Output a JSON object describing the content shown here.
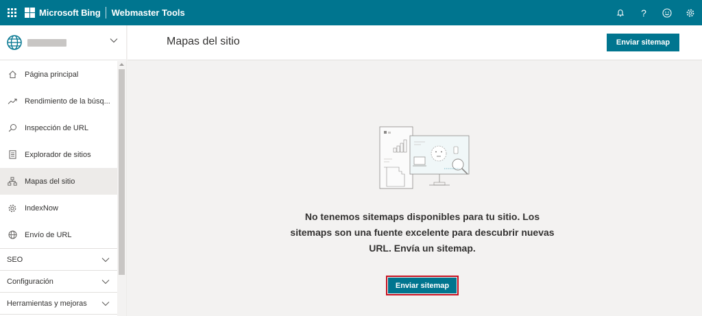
{
  "topbar": {
    "brand": "Microsoft Bing",
    "product": "Webmaster Tools",
    "background": "#00758f",
    "icons": [
      "waffle-icon",
      "bell-icon",
      "help-icon",
      "smiley-icon",
      "gear-icon"
    ],
    "help_glyph": "?"
  },
  "sidebar": {
    "nav_items": [
      {
        "label": "Página principal",
        "icon": "home-icon"
      },
      {
        "label": "Rendimiento de la búsq...",
        "icon": "trend-icon"
      },
      {
        "label": "Inspección de URL",
        "icon": "search-icon"
      },
      {
        "label": "Explorador de sitios",
        "icon": "document-icon"
      },
      {
        "label": "Mapas del sitio",
        "icon": "sitemap-icon",
        "active": true
      },
      {
        "label": "IndexNow",
        "icon": "gear-icon"
      },
      {
        "label": "Envío de URL",
        "icon": "globe-icon"
      }
    ],
    "groups": [
      {
        "label": "SEO"
      },
      {
        "label": "Configuración"
      },
      {
        "label": "Herramientas y mejoras"
      }
    ]
  },
  "header": {
    "title": "Mapas del sitio",
    "submit_label": "Enviar sitemap"
  },
  "main": {
    "empty_message": "No tenemos sitemaps disponibles para tu sitio. Los sitemaps son una fuente excelente para descubrir nuevas URL. Envía un sitemap.",
    "submit_label": "Enviar sitemap"
  },
  "colors": {
    "accent": "#00758f",
    "highlight_border": "#c50f1f"
  }
}
